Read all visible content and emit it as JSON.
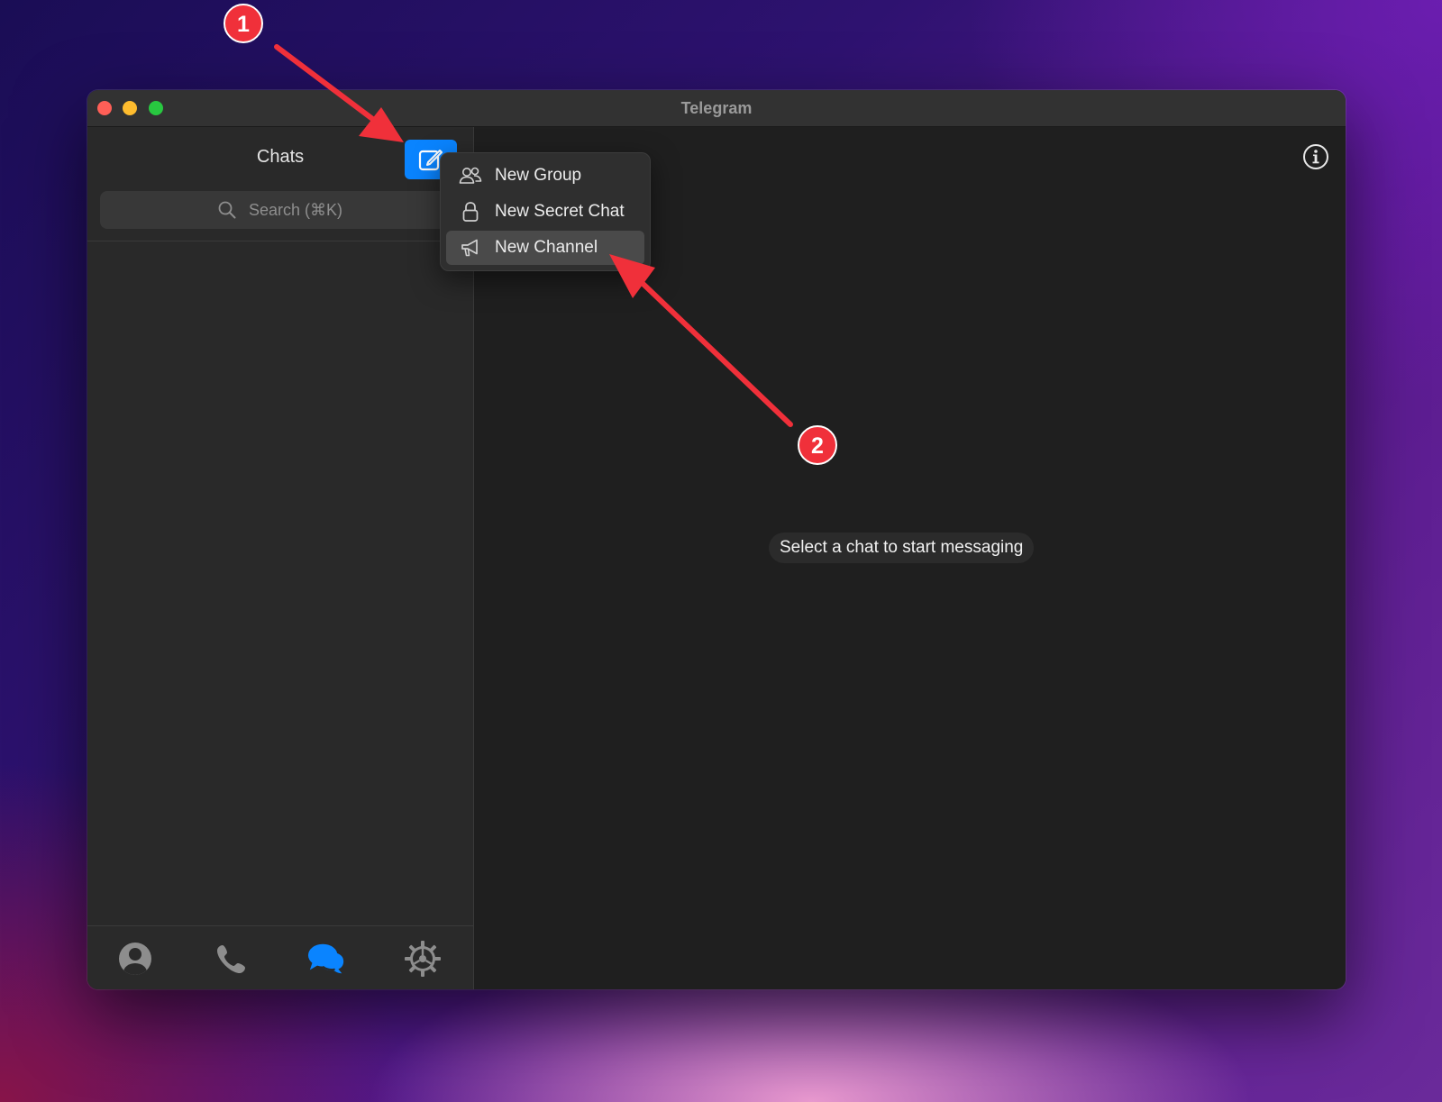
{
  "window": {
    "title": "Telegram"
  },
  "sidebar": {
    "header_title": "Chats",
    "search": {
      "placeholder": "Search (⌘K)"
    },
    "tabs": [
      {
        "name": "contacts",
        "icon": "person-circle-icon"
      },
      {
        "name": "calls",
        "icon": "phone-icon"
      },
      {
        "name": "chats",
        "icon": "chat-bubbles-icon",
        "active": true
      },
      {
        "name": "settings",
        "icon": "gear-icon"
      }
    ]
  },
  "compose_menu": {
    "items": [
      {
        "label": "New Group",
        "icon": "people-icon"
      },
      {
        "label": "New Secret Chat",
        "icon": "lock-icon"
      },
      {
        "label": "New Channel",
        "icon": "megaphone-icon",
        "highlighted": true
      }
    ]
  },
  "main": {
    "empty_message": "Select a chat to start messaging"
  },
  "annotations": [
    {
      "number": "1",
      "target": "compose-button"
    },
    {
      "number": "2",
      "target": "new-channel"
    }
  ],
  "colors": {
    "accent": "#0a84ff",
    "annotation_red": "#f0303a",
    "traffic_red": "#ff5f57",
    "traffic_yellow": "#febc2e",
    "traffic_green": "#28c840"
  }
}
